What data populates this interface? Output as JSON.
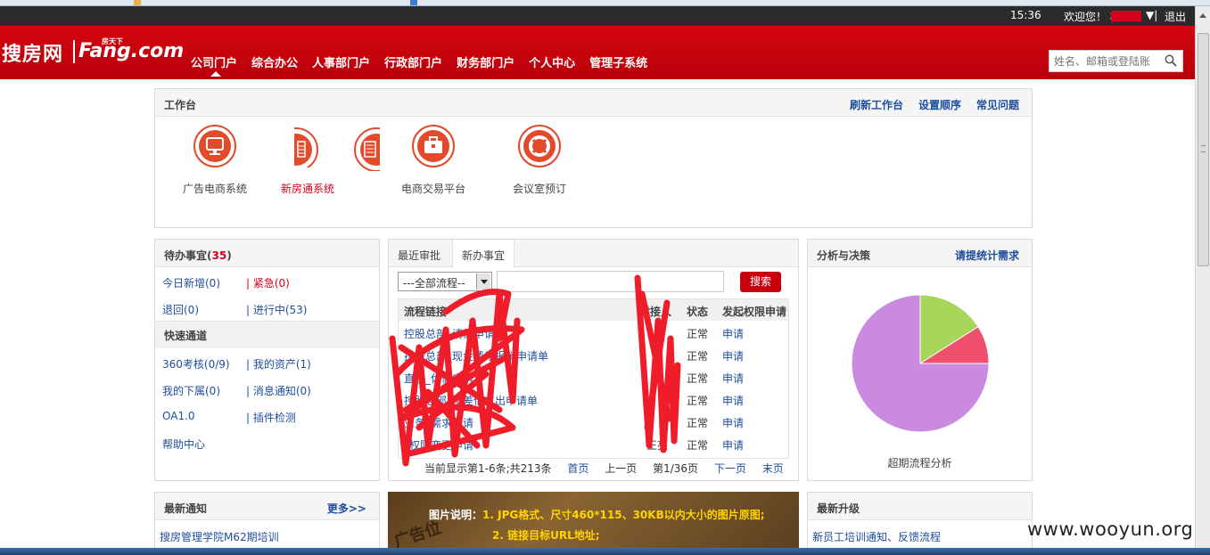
{
  "topbar": {
    "time": "15:36",
    "welcome": "欢迎您！ 核",
    "caret": "▼|",
    "logout": "退出"
  },
  "header": {
    "logo_cn": "搜房网",
    "logo_en": "Fang.com",
    "logo_small": "房天下",
    "nav": [
      "公司门户",
      "综合办公",
      "人事部门户",
      "行政部门户",
      "财务部门户",
      "个人中心",
      "管理子系统"
    ],
    "search_placeholder": "姓名、邮箱或登陆账"
  },
  "workbench": {
    "title": "工作台",
    "links": [
      "刷新工作台",
      "设置顺序",
      "常见问题"
    ],
    "apps": [
      {
        "label": "广告电商系统",
        "icon": "monitor-icon"
      },
      {
        "label": "新房通系统",
        "icon": "phone-icon",
        "accent": "#d6001c"
      },
      {
        "label": "",
        "icon": "document-icon"
      },
      {
        "label": "电商交易平台",
        "icon": "briefcase-icon"
      },
      {
        "label": "会议室预订",
        "icon": "lifebuoy-icon"
      }
    ]
  },
  "todo": {
    "title_prefix": "待办事宜(",
    "count": "35",
    "title_suffix": ")",
    "rows": [
      [
        "今日新增(0)",
        "| 紧急(0)"
      ],
      [
        "退回(0)",
        "| 进行中(53)"
      ]
    ],
    "quick_title": "快速通道",
    "quick_rows": [
      [
        "360考核(0/9)",
        "| 我的资产(1)"
      ],
      [
        "我的下属(0)",
        "| 消息通知(0)"
      ],
      [
        "OA1.0",
        "| 插件检测"
      ],
      [
        "帮助中心",
        ""
      ]
    ]
  },
  "approvals": {
    "tabs": [
      "最近审批",
      "新办事宜"
    ],
    "select_value": "---全部流程--",
    "search_label": "搜索",
    "columns": [
      "流程链接",
      "对接人",
      "状态",
      "发起权限申请"
    ],
    "rows": [
      {
        "link": "控股总部_请假申请",
        "person": "",
        "status": "正常",
        "action": "申请"
      },
      {
        "link": "控股总部_现金费用报销申请单",
        "person": "",
        "status": "正常",
        "action": "申请"
      },
      {
        "link": "直接_休假申请",
        "person": "",
        "status": "正常",
        "action": "申请"
      },
      {
        "link": "控股总部_出差借支出申请单",
        "person": "",
        "status": "正常",
        "action": "申请"
      },
      {
        "link": "业务_需求申请",
        "person": "",
        "status": "正常",
        "action": "申请"
      },
      {
        "link": "_权限变更申请",
        "person": "王亮",
        "status": "正常",
        "action": "申请"
      }
    ],
    "pager": {
      "info": "当前显示第1-6条;共213条",
      "first": "首页",
      "prev": "上一页",
      "page": "第1/36页",
      "next": "下一页",
      "last": "末页"
    }
  },
  "analysis": {
    "title": "分析与决策",
    "link": "请提统计需求",
    "caption": "超期流程分析",
    "chart_data": {
      "type": "pie",
      "values": [
        16,
        9,
        75
      ],
      "colors": [
        "#a8d65a",
        "#f0506e",
        "#c98ae0"
      ]
    }
  },
  "notices": {
    "title": "最新通知",
    "more": "更多>>",
    "first": "搜房管理学院M62期培训"
  },
  "banner": {
    "line1_label": "图片说明：",
    "line1": "1. JPG格式、尺寸460*115、30KB以内大小的图片原图;",
    "line2": "2. 链接目标URL地址;",
    "stamp": "广告位"
  },
  "upgrades": {
    "title": "最新升级",
    "first": "新员工培训通知、反馈流程"
  },
  "watermark": "www.wooyun.org"
}
